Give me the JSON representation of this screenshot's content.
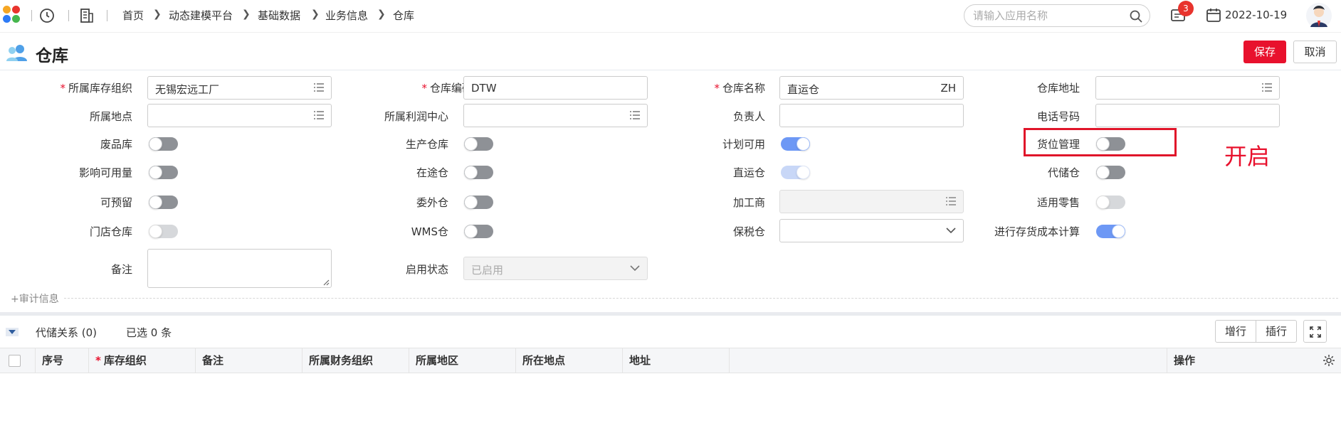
{
  "header": {
    "breadcrumb": [
      "首页",
      "动态建模平台",
      "基础数据",
      "业务信息",
      "仓库"
    ],
    "search_placeholder": "请输入应用名称",
    "notification_count": "3",
    "date": "2022-10-19"
  },
  "page": {
    "title": "仓库",
    "save_label": "保存",
    "cancel_label": "取消"
  },
  "form": {
    "inv_org": {
      "label": "所属库存组织",
      "value": "无锡宏远工厂"
    },
    "wh_code": {
      "label": "仓库编码",
      "value": "DTW"
    },
    "wh_name": {
      "label": "仓库名称",
      "value": "直运仓",
      "suffix": "ZH"
    },
    "wh_address": {
      "label": "仓库地址",
      "value": ""
    },
    "location": {
      "label": "所属地点",
      "value": ""
    },
    "profit_center": {
      "label": "所属利润中心",
      "value": ""
    },
    "manager": {
      "label": "负责人",
      "value": ""
    },
    "phone": {
      "label": "电话号码",
      "value": ""
    },
    "waste_wh": {
      "label": "废品库",
      "on": false
    },
    "production_wh": {
      "label": "生产仓库",
      "on": false
    },
    "plan_available": {
      "label": "计划可用",
      "on": true
    },
    "bin_mgmt": {
      "label": "货位管理",
      "on": false
    },
    "affect_available": {
      "label": "影响可用量",
      "on": false
    },
    "in_transit": {
      "label": "在途仓",
      "on": false
    },
    "direct_ship": {
      "label": "直运仓",
      "on": true
    },
    "consignment": {
      "label": "代储仓",
      "on": false
    },
    "reservable": {
      "label": "可预留",
      "on": false
    },
    "outsourced": {
      "label": "委外仓",
      "on": false
    },
    "processor": {
      "label": "加工商",
      "value": ""
    },
    "retail_applicable": {
      "label": "适用零售",
      "on": false
    },
    "store_wh": {
      "label": "门店仓库",
      "on": false
    },
    "wms_wh": {
      "label": "WMS仓",
      "on": false
    },
    "bonded": {
      "label": "保税仓",
      "value": ""
    },
    "cost_calc": {
      "label": "进行存货成本计算",
      "on": true
    },
    "remark": {
      "label": "备注",
      "value": ""
    },
    "status": {
      "label": "启用状态",
      "value": "已启用"
    },
    "audit_label": "+审计信息"
  },
  "annotation": {
    "text": "开启",
    "color": "#e8112d"
  },
  "grid": {
    "title": "代储关系 (0)",
    "selected": "已选 0 条",
    "add_row": "增行",
    "insert_row": "插行",
    "columns": [
      "序号",
      "库存组织",
      "备注",
      "所属财务组织",
      "所属地区",
      "所在地点",
      "地址",
      "操作"
    ]
  },
  "colors": {
    "accent_red": "#e8112d",
    "toggle_on": "#6d98f5",
    "toggle_off": "#8e9196"
  }
}
